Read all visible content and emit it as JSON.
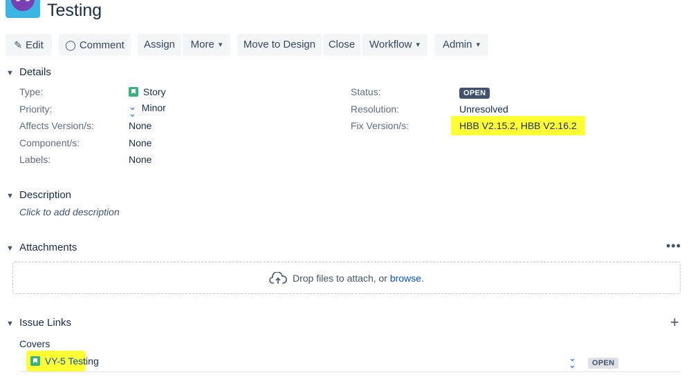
{
  "header": {
    "title": "Testing"
  },
  "toolbar": {
    "edit": "Edit",
    "comment": "Comment",
    "assign": "Assign",
    "more": "More",
    "move_to_design": "Move to Design",
    "close": "Close",
    "workflow": "Workflow",
    "admin": "Admin"
  },
  "details": {
    "title": "Details",
    "left": [
      {
        "label": "Type:",
        "value": "Story",
        "icon": "story-icon"
      },
      {
        "label": "Priority:",
        "value": "Minor",
        "icon": "priority-minor-icon"
      },
      {
        "label": "Affects Version/s:",
        "value": "None"
      },
      {
        "label": "Component/s:",
        "value": "None"
      },
      {
        "label": "Labels:",
        "value": "None"
      }
    ],
    "right": [
      {
        "label": "Status:",
        "value": "OPEN"
      },
      {
        "label": "Resolution:",
        "value": "Unresolved"
      },
      {
        "label": "Fix Version/s:",
        "value": "HBB V2.15.2, HBB V2.16.2"
      }
    ]
  },
  "description": {
    "title": "Description",
    "placeholder": "Click to add description"
  },
  "attachments": {
    "title": "Attachments",
    "drop_text": "Drop files to attach, or",
    "browse": "browse."
  },
  "issue_links": {
    "title": "Issue Links",
    "group": "Covers",
    "items": [
      {
        "key_part": "VY-5 Tes",
        "rest": "ting",
        "status": "OPEN"
      }
    ]
  },
  "colors": {
    "highlight": "#ffff33",
    "link": "#0052cc",
    "story": "#36b37e",
    "status_dark": "#42526e"
  }
}
